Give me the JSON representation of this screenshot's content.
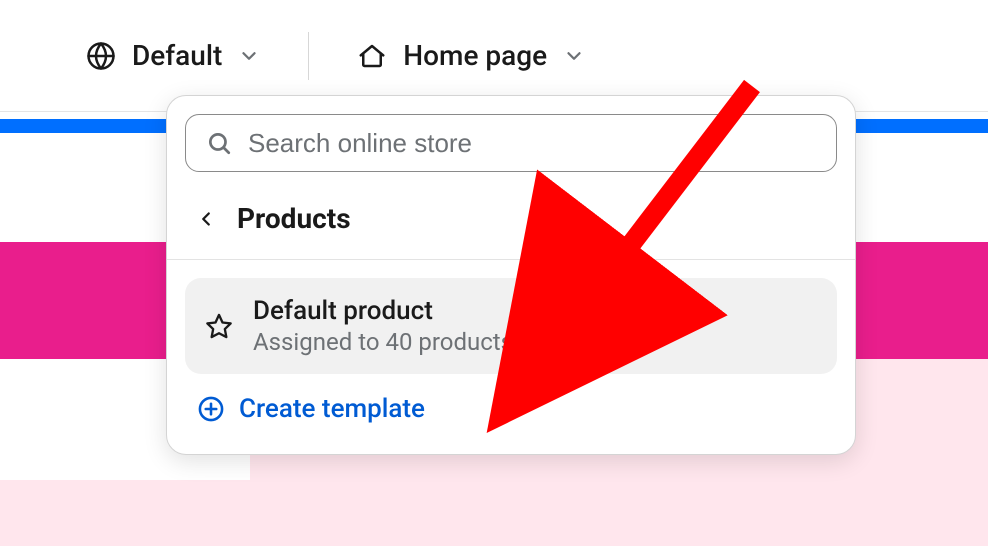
{
  "toolbar": {
    "theme_label": "Default",
    "page_label": "Home page"
  },
  "popover": {
    "search_placeholder": "Search online store",
    "section_label": "Products",
    "item": {
      "title": "Default product",
      "subtitle": "Assigned to 40 products"
    },
    "create_label": "Create template"
  }
}
